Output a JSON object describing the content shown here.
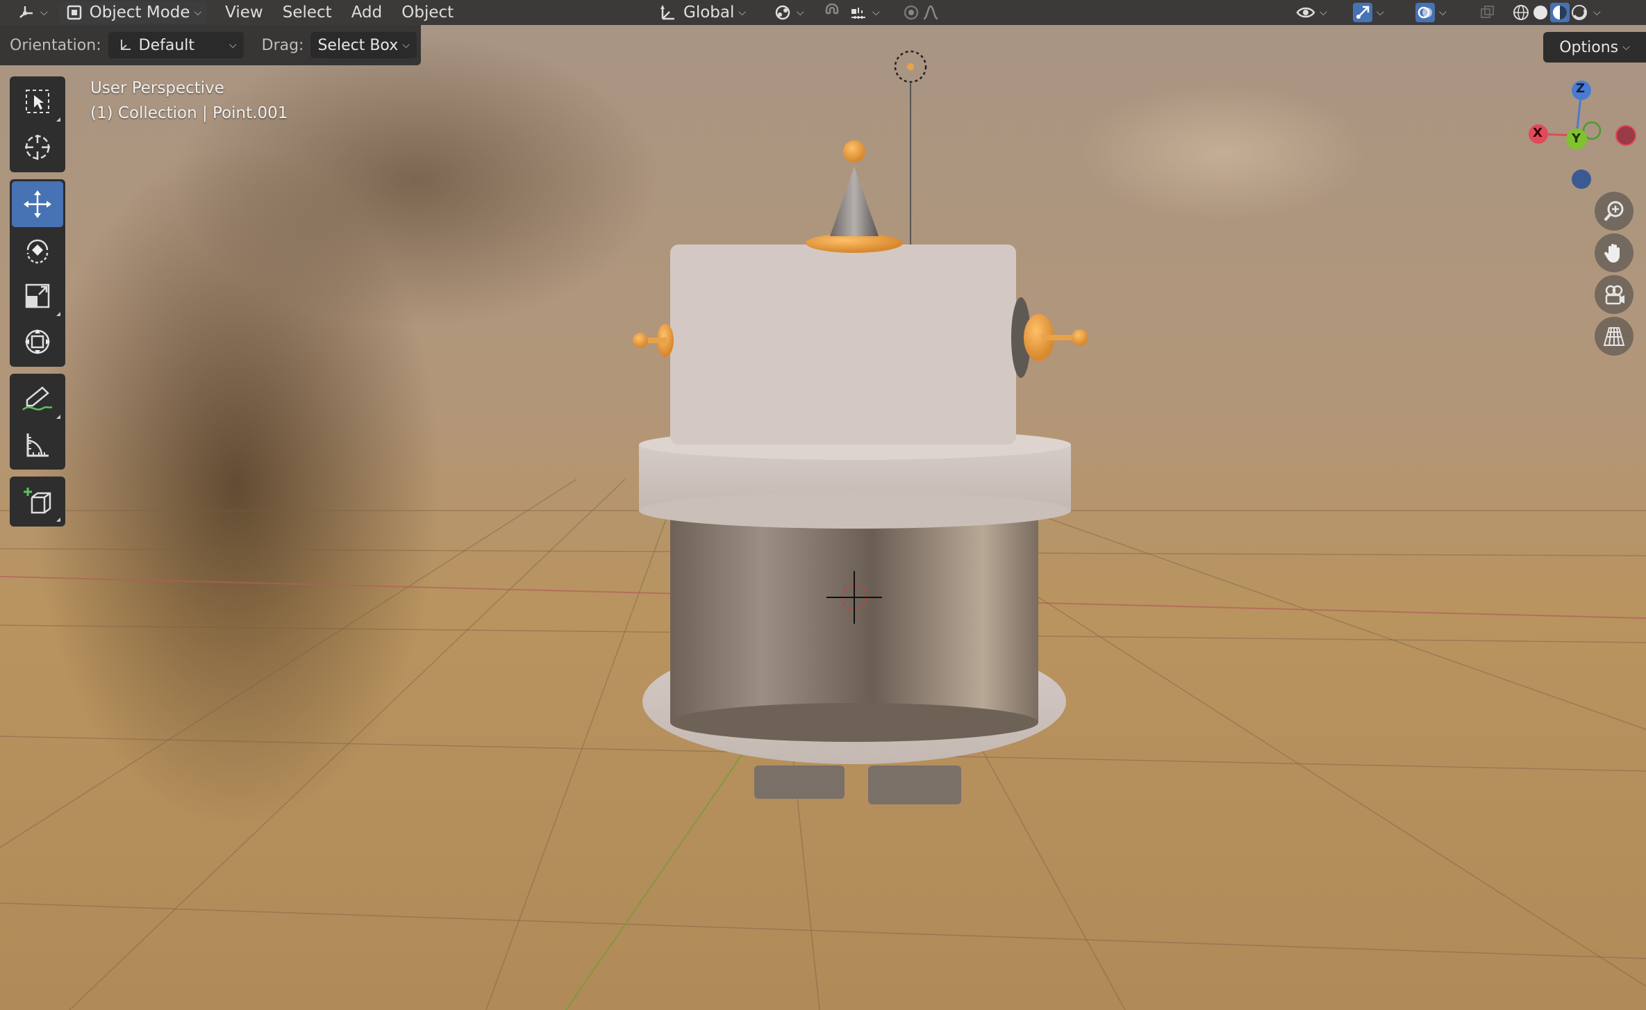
{
  "header": {
    "editor_type_icon": "3d-viewport-icon",
    "mode": "Object Mode",
    "menus": [
      "View",
      "Select",
      "Add",
      "Object"
    ],
    "transform_orientation": "Global",
    "pivot_icon": "pivot-point-icon",
    "snap_icon": "snap-magnet-icon",
    "proportional_icon": "proportional-edit-icon",
    "visibility_icon": "eye-icon",
    "gizmo_icon": "gizmo-icon",
    "overlay_icon": "overlay-icon",
    "shading_modes": [
      "wireframe",
      "solid",
      "material-preview",
      "rendered"
    ],
    "active_shading": "material-preview"
  },
  "toolsettings": {
    "orientation_label": "Orientation:",
    "orientation_value": "Default",
    "drag_label": "Drag:",
    "drag_value": "Select Box",
    "options_label": "Options"
  },
  "toolbar": {
    "tools": [
      "select-box",
      "cursor",
      "move",
      "rotate",
      "scale",
      "transform",
      "annotate",
      "measure",
      "add-cube"
    ],
    "active_tool": "move"
  },
  "viewport": {
    "view_name": "User Perspective",
    "collection_info": "(1) Collection | Point.001"
  },
  "gizmo": {
    "axes": [
      "X",
      "Y",
      "Z"
    ],
    "colors": {
      "x": "#e04a5b",
      "y": "#7fc32e",
      "z": "#4a7bd2"
    }
  },
  "colors": {
    "header_bg": "#323232",
    "active_tool": "#4772b3",
    "robot_body": "#cfc3bf",
    "robot_metal": "#8a7d70",
    "robot_accent": "#e8a248"
  }
}
